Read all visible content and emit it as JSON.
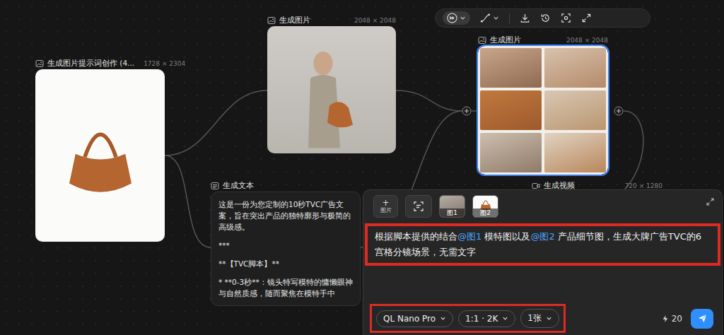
{
  "nodes": [
    {
      "kind": "product-image",
      "title": "生成图片提示词创作 (4...",
      "size": "1728 × 2304",
      "selected": false
    },
    {
      "kind": "model-image",
      "title": "生成图片",
      "size": "2048 × 2048",
      "selected": false
    },
    {
      "kind": "storyboard-image",
      "title": "生成图片",
      "size": "2048 × 2048",
      "selected": true
    },
    {
      "kind": "text",
      "title": "生成文本",
      "lines": [
        "这是一份为您定制的10秒TVC广告文案，旨在突出产品的独特廓形与极简的高级感。",
        "***",
        "**【TVC脚本】**",
        "*   **0-3秒**：镜头特写模特的慵懒眼神与自然质感，随而聚焦在模特手中"
      ],
      "selected": false
    },
    {
      "kind": "video",
      "title": "生成视频",
      "size": "720 × 1280",
      "selected": false
    }
  ],
  "prompt": {
    "add": {
      "icon": "+",
      "label": "图片"
    },
    "refs": [
      {
        "label": "图1",
        "kind": "model",
        "selected": false
      },
      {
        "label": "图2",
        "kind": "product",
        "selected": false
      }
    ],
    "segments": [
      {
        "text": "根据脚本提供的结合",
        "mention": false
      },
      {
        "text": "@图1",
        "mention": true
      },
      {
        "text": " 模特图以及",
        "mention": false
      },
      {
        "text": "@图2",
        "mention": true
      },
      {
        "text": " 产品细节图，生成大牌广告TVC的6宫格分镜场景，无需文字",
        "mention": false
      }
    ],
    "selectors": [
      {
        "label": "QL Nano Pro"
      },
      {
        "label": "1:1 · 2K"
      },
      {
        "label": "1张"
      }
    ],
    "credits": "20"
  }
}
